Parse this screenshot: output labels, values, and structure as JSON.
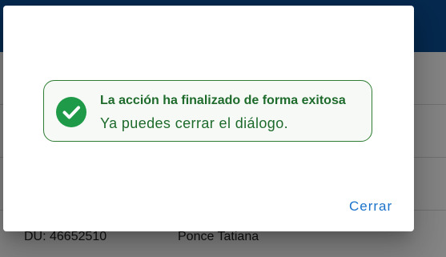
{
  "background_table": {
    "visible_row": {
      "document": "DU: 46652510",
      "name": "Ponce Tatiana"
    }
  },
  "dialog": {
    "alert": {
      "icon": "check-circle-icon",
      "title": "La acción ha finalizado de forma exitosa",
      "message": "Ya puedes cerrar el diálogo."
    },
    "close_label": "Cerrar"
  },
  "colors": {
    "header": "#0d4f97",
    "success_green": "#1f9a48",
    "success_text": "#1e6b2c",
    "action_blue": "#1a73c9"
  }
}
